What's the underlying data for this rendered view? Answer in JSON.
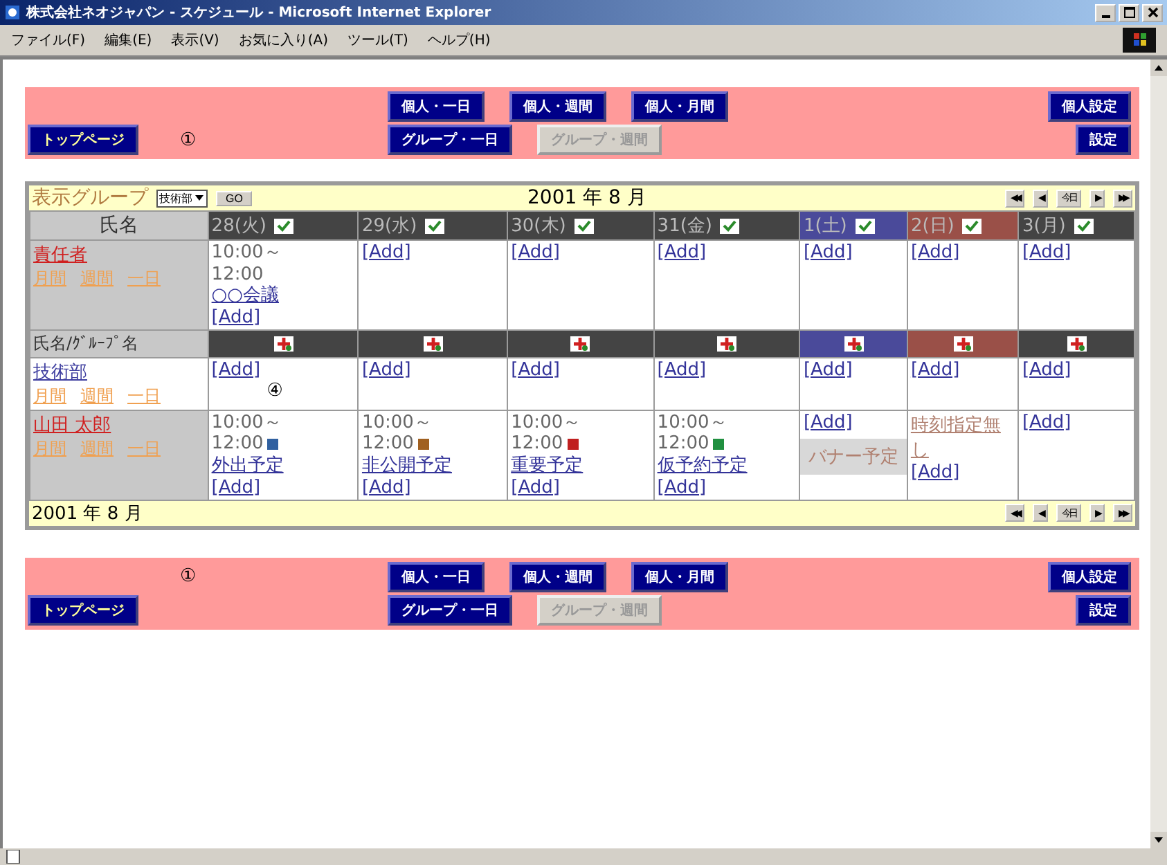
{
  "window": {
    "title": "株式会社ネオジャパン - スケジュール - Microsoft Internet Explorer"
  },
  "menu": [
    "ファイル(F)",
    "編集(E)",
    "表示(V)",
    "お気に入り(A)",
    "ツール(T)",
    "ヘルプ(H)"
  ],
  "bands": [
    {
      "lower_marker": "①",
      "top_page": "トップページ",
      "row1": [
        {
          "label": "個人・一日",
          "disabled": false
        },
        {
          "label": "個人・週間",
          "disabled": false
        },
        {
          "label": "個人・月間",
          "disabled": false
        }
      ],
      "row2": [
        {
          "label": "グループ・一日",
          "disabled": false
        },
        {
          "label": "グループ・週間",
          "disabled": true
        }
      ],
      "personal_settings": "個人設定",
      "settings": "設定"
    },
    {
      "upper_marker": "①",
      "top_page": "トップページ",
      "row1": [
        {
          "label": "個人・一日",
          "disabled": false
        },
        {
          "label": "個人・週間",
          "disabled": false
        },
        {
          "label": "個人・月間",
          "disabled": false
        }
      ],
      "row2": [
        {
          "label": "グループ・一日",
          "disabled": false
        },
        {
          "label": "グループ・週間",
          "disabled": true
        }
      ],
      "personal_settings": "個人設定",
      "settings": "設定"
    }
  ],
  "calendar": {
    "group_label": "表示グループ",
    "group_select": "技術部",
    "go_button": "GO",
    "month": "2001 年 8 月",
    "nav": [
      "◀◀",
      "◀",
      "今日",
      "▶",
      "▶▶"
    ],
    "name_heading": "氏名",
    "columns": [
      {
        "label": "28(火)",
        "kind": "weekday"
      },
      {
        "label": "29(水)",
        "kind": "weekday"
      },
      {
        "label": "30(木)",
        "kind": "weekday"
      },
      {
        "label": "31(金)",
        "kind": "weekday"
      },
      {
        "label": "1(土)",
        "kind": "saturday"
      },
      {
        "label": "2(日)",
        "kind": "sunday"
      },
      {
        "label": "3(月)",
        "kind": "weekday"
      }
    ],
    "rows": [
      {
        "kind": "user",
        "name": "責任者",
        "links": [
          "月間",
          "週間",
          "一日"
        ],
        "cells": [
          [
            {
              "kind": "event",
              "start": "10:00～",
              "end": "12:00",
              "title": "○○会議"
            },
            {
              "kind": "add",
              "label": "[Add]"
            }
          ],
          [
            {
              "kind": "add",
              "label": "[Add]"
            }
          ],
          [
            {
              "kind": "add",
              "label": "[Add]"
            }
          ],
          [
            {
              "kind": "add",
              "label": "[Add]"
            }
          ],
          [
            {
              "kind": "add",
              "label": "[Add]"
            }
          ],
          [
            {
              "kind": "add",
              "label": "[Add]"
            }
          ],
          [
            {
              "kind": "add",
              "label": "[Add]"
            }
          ]
        ]
      },
      {
        "kind": "divider",
        "name": "氏名/ｸﾞﾙｰﾌﾟ名"
      },
      {
        "kind": "group",
        "name": "技術部",
        "links": [
          "月間",
          "週間",
          "一日"
        ],
        "cells": [
          [
            {
              "kind": "add",
              "label": "[Add]"
            },
            {
              "kind": "note",
              "label": "④"
            }
          ],
          [
            {
              "kind": "add",
              "label": "[Add]"
            }
          ],
          [
            {
              "kind": "add",
              "label": "[Add]"
            }
          ],
          [
            {
              "kind": "add",
              "label": "[Add]"
            }
          ],
          [
            {
              "kind": "add",
              "label": "[Add]"
            }
          ],
          [
            {
              "kind": "add",
              "label": "[Add]"
            }
          ],
          [
            {
              "kind": "add",
              "label": "[Add]"
            }
          ]
        ]
      },
      {
        "kind": "user",
        "name": "山田 太郎",
        "links": [
          "月間",
          "週間",
          "一日"
        ],
        "cells": [
          [
            {
              "kind": "event",
              "start": "10:00～",
              "end": "12:00",
              "color": "#3060a0",
              "title": "外出予定"
            },
            {
              "kind": "add",
              "label": "[Add]"
            }
          ],
          [
            {
              "kind": "event",
              "start": "10:00～",
              "end": "12:00",
              "color": "#a06020",
              "title": "非公開予定"
            },
            {
              "kind": "add",
              "label": "[Add]"
            }
          ],
          [
            {
              "kind": "event",
              "start": "10:00～",
              "end": "12:00",
              "color": "#c02020",
              "title": "重要予定"
            },
            {
              "kind": "add",
              "label": "[Add]"
            }
          ],
          [
            {
              "kind": "event",
              "start": "10:00～",
              "end": "12:00",
              "color": "#209040",
              "title": "仮予約予定"
            },
            {
              "kind": "add",
              "label": "[Add]"
            }
          ],
          [
            {
              "kind": "add",
              "label": "[Add]"
            },
            {
              "kind": "banner",
              "label": "バナー予定"
            }
          ],
          [
            {
              "kind": "untimed",
              "label": "時刻指定無し"
            },
            {
              "kind": "add",
              "label": "[Add]"
            }
          ],
          [
            {
              "kind": "add",
              "label": "[Add]"
            }
          ]
        ]
      }
    ],
    "footer_month": "2001 年 8 月",
    "footer_nav": [
      "◀◀",
      "◀",
      "今日",
      "▶",
      "▶▶"
    ]
  }
}
